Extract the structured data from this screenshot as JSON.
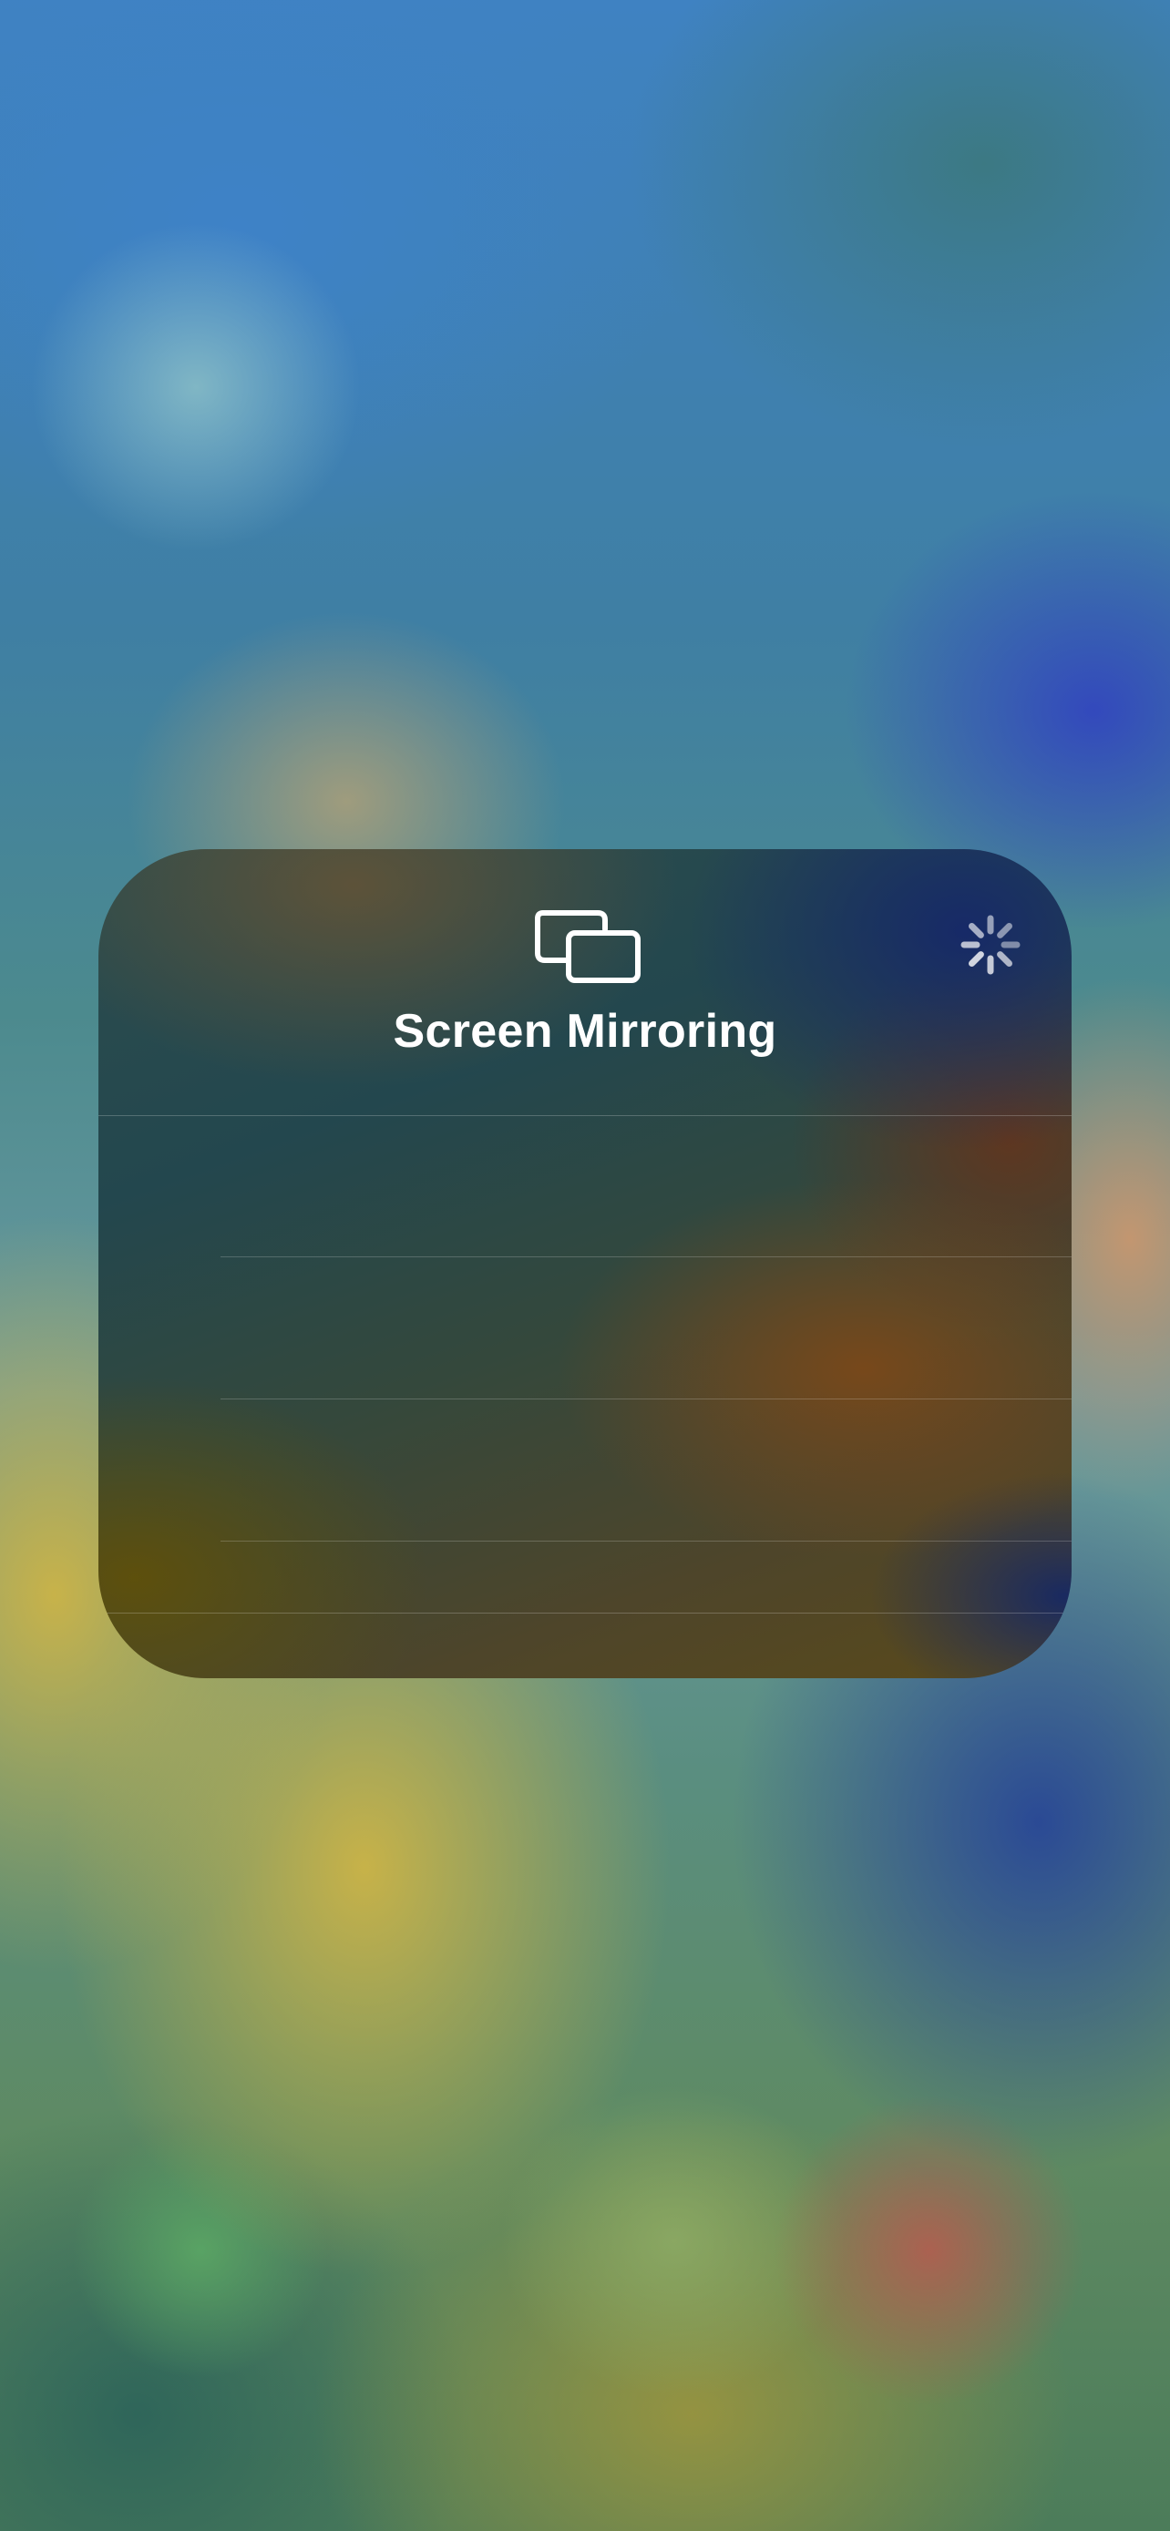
{
  "screen": {
    "wallpaper": "blurred-colorful-wallpaper"
  },
  "panel": {
    "title": "Screen Mirroring",
    "icon": "screen-mirroring-icon",
    "status_indicator": "loading-spinner",
    "devices": [
      {
        "label": ""
      },
      {
        "label": ""
      },
      {
        "label": ""
      }
    ]
  }
}
